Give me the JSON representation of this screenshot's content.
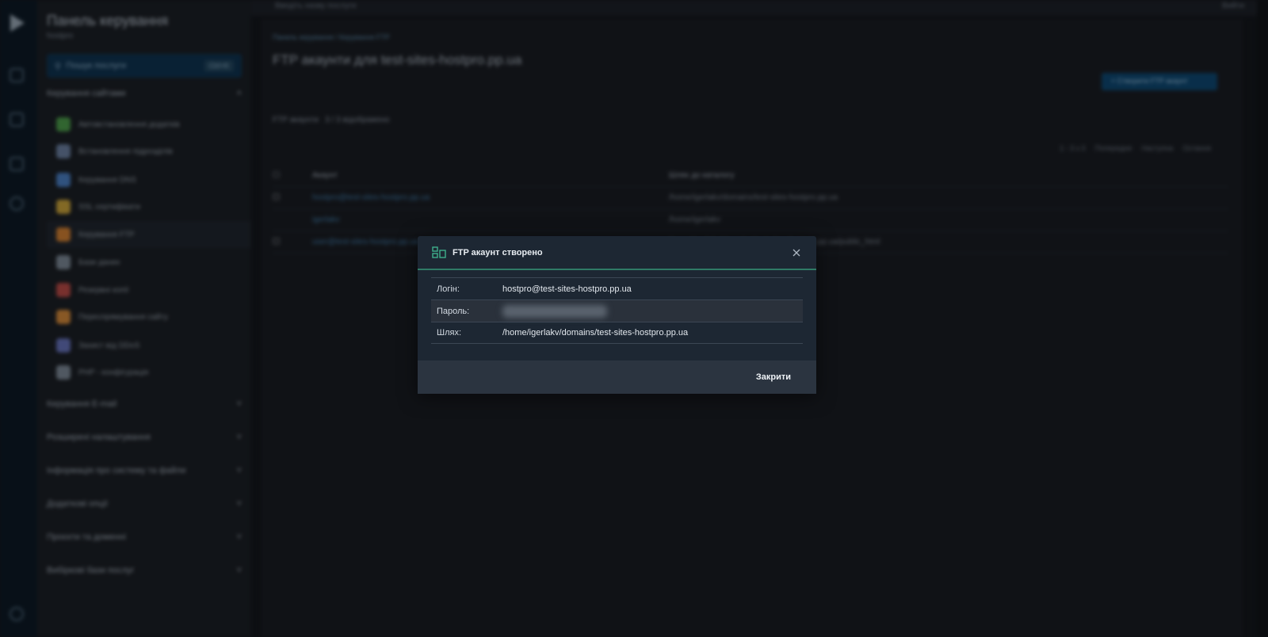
{
  "sidebar": {
    "title": "Панель керування",
    "subtitle": "hostpro",
    "search_placeholder": "Пошук послуги",
    "search_hint": "Ctrl+K",
    "active_group": "Керування сайтами",
    "items": [
      {
        "label": "Автовстановлення додатків",
        "icon_color": "#4c9b4a"
      },
      {
        "label": "Встановлення підрозділів",
        "icon_color": "#6a7fa0"
      },
      {
        "label": "Керування DNS",
        "icon_color": "#4a7ec2"
      },
      {
        "label": "SSL сертифікати",
        "icon_color": "#c9a23a"
      },
      {
        "label": "Керування FTP",
        "icon_color": "#d07f32"
      },
      {
        "label": "Бази даних",
        "icon_color": "#7c8896"
      },
      {
        "label": "Резервні копії",
        "icon_color": "#b84a46"
      },
      {
        "label": "Переспрямування сайту",
        "icon_color": "#d2883a"
      },
      {
        "label": "Захист від DDoS",
        "icon_color": "#6571b8"
      },
      {
        "label": "PHP - конфігурація",
        "icon_color": "#7c8896"
      }
    ],
    "groups": [
      "Керування E-mail",
      "Розширені налаштування",
      "Інформація про систему та файли",
      "Додаткові опції",
      "Проєкти та доменні",
      "Вибіркові бази послуг"
    ]
  },
  "topbar": {
    "search": "Введіть назву послуги",
    "right": "Вийти"
  },
  "main": {
    "breadcrumb": "Панель керування / Керування FTP",
    "title": "FTP акаунти для test-sites-hostpro.pp.ua",
    "add_button": "+ Створити FTP акаунт",
    "filter_label": "FTP акаунти",
    "filter_count": "3 / 3 відображено",
    "pagination": [
      "1 - 3 з 3",
      "Попередня",
      "Наступна",
      "Остання"
    ],
    "table": {
      "headers": [
        "Акаунт",
        "Шлях до каталогу"
      ],
      "rows": [
        [
          "hostpro@test-sites-hostpro.pp.ua",
          "/home/igerlakv/domains/test-sites-hostpro.pp.ua"
        ],
        [
          "igerlakv",
          "/home/igerlakv"
        ],
        [
          "user@test-sites-hostpro.pp.ua",
          "/home/igerlakv/domains/test-sites-hostpro.pp.ua/public_html"
        ]
      ]
    }
  },
  "modal": {
    "title": "FTP акаунт створено",
    "login_label": "Логін:",
    "login_value": "hostpro@test-sites-hostpro.pp.ua",
    "password_label": "Пароль:",
    "path_label": "Шлях:",
    "path_value": "/home/igerlakv/domains/test-sites-hostpro.pp.ua",
    "close_button": "Закрити",
    "accent_color": "#2f7b66",
    "icon": "ftp-server-icon"
  }
}
